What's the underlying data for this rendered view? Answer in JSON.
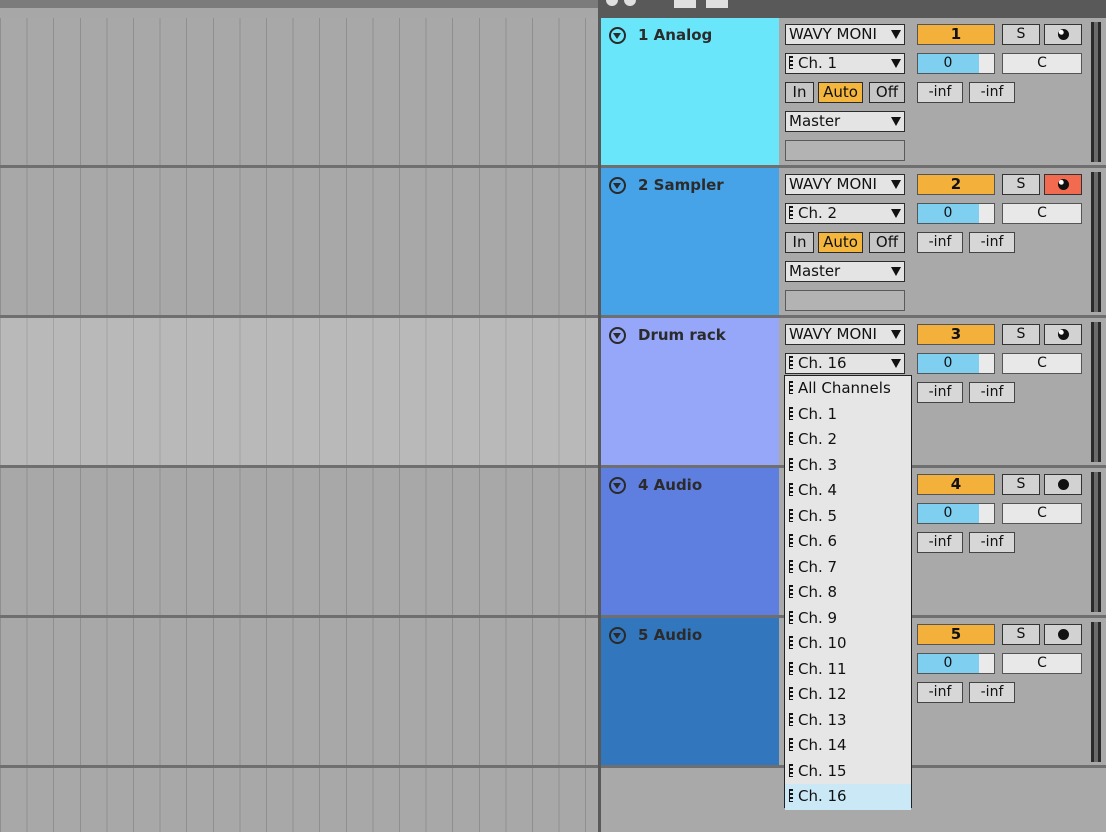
{
  "tracks": [
    {
      "name": "1 Analog",
      "color": "#6ae6fb",
      "show_fold": true,
      "input_type": "WAVY MONI",
      "input_channel": "Ch. 1",
      "monitor": [
        "In",
        "Auto",
        "Off"
      ],
      "output": "Master",
      "number": "1",
      "solo": "S",
      "arm": "half",
      "volume": "0",
      "pan": "C",
      "peak_left": "-inf",
      "peak_right": "-inf"
    },
    {
      "name": "2 Sampler",
      "color": "#47a3e8",
      "show_fold": true,
      "input_type": "WAVY MONI",
      "input_channel": "Ch. 2",
      "monitor": [
        "In",
        "Auto",
        "Off"
      ],
      "output": "Master",
      "number": "2",
      "solo": "S",
      "arm": "rec",
      "volume": "0",
      "pan": "C",
      "peak_left": "-inf",
      "peak_right": "-inf"
    },
    {
      "name": "Drum rack",
      "color": "#96a6f8",
      "show_fold": true,
      "input_type": "WAVY MONI",
      "input_channel": "Ch. 16",
      "number": "3",
      "solo": "S",
      "arm": "half",
      "volume": "0",
      "pan": "C",
      "peak_left": "-inf",
      "peak_right": "-inf"
    },
    {
      "name": "4 Audio",
      "color": "#5f7fe0",
      "show_fold": true,
      "number": "4",
      "solo": "S",
      "arm": "dot",
      "volume": "0",
      "pan": "C",
      "peak_left": "-inf",
      "peak_right": "-inf"
    },
    {
      "name": "5 Audio",
      "color": "#3277be",
      "show_fold": true,
      "number": "5",
      "solo": "S",
      "arm": "dot",
      "volume": "0",
      "pan": "C",
      "peak_left": "-inf",
      "peak_right": "-inf"
    }
  ],
  "dropdown": {
    "items": [
      "All Channels",
      "Ch. 1",
      "Ch. 2",
      "Ch. 3",
      "Ch. 4",
      "Ch. 5",
      "Ch. 6",
      "Ch. 7",
      "Ch. 8",
      "Ch. 9",
      "Ch. 10",
      "Ch. 11",
      "Ch. 12",
      "Ch. 13",
      "Ch. 14",
      "Ch. 15",
      "Ch. 16"
    ],
    "selected": "Ch. 16"
  }
}
